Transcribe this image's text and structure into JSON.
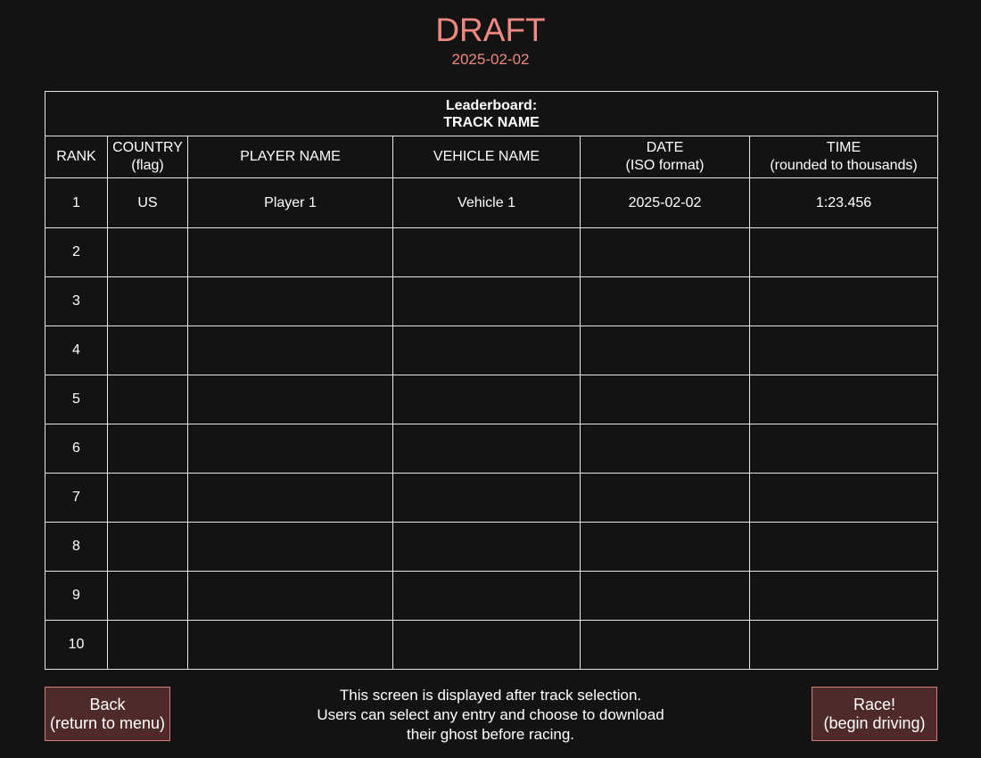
{
  "header": {
    "title": "DRAFT",
    "date": "2025-02-02"
  },
  "leaderboard": {
    "caption_line1": "Leaderboard:",
    "caption_line2": "TRACK NAME",
    "columns": [
      {
        "line1": "RANK",
        "line2": ""
      },
      {
        "line1": "COUNTRY",
        "line2": "(flag)"
      },
      {
        "line1": "PLAYER NAME",
        "line2": ""
      },
      {
        "line1": "VEHICLE NAME",
        "line2": ""
      },
      {
        "line1": "DATE",
        "line2": "(ISO format)"
      },
      {
        "line1": "TIME",
        "line2": "(rounded to thousands)"
      }
    ],
    "rows": [
      {
        "rank": "1",
        "country": "US",
        "player": "Player 1",
        "vehicle": "Vehicle 1",
        "date": "2025-02-02",
        "time": "1:23.456"
      },
      {
        "rank": "2",
        "country": "",
        "player": "",
        "vehicle": "",
        "date": "",
        "time": ""
      },
      {
        "rank": "3",
        "country": "",
        "player": "",
        "vehicle": "",
        "date": "",
        "time": ""
      },
      {
        "rank": "4",
        "country": "",
        "player": "",
        "vehicle": "",
        "date": "",
        "time": ""
      },
      {
        "rank": "5",
        "country": "",
        "player": "",
        "vehicle": "",
        "date": "",
        "time": ""
      },
      {
        "rank": "6",
        "country": "",
        "player": "",
        "vehicle": "",
        "date": "",
        "time": ""
      },
      {
        "rank": "7",
        "country": "",
        "player": "",
        "vehicle": "",
        "date": "",
        "time": ""
      },
      {
        "rank": "8",
        "country": "",
        "player": "",
        "vehicle": "",
        "date": "",
        "time": ""
      },
      {
        "rank": "9",
        "country": "",
        "player": "",
        "vehicle": "",
        "date": "",
        "time": ""
      },
      {
        "rank": "10",
        "country": "",
        "player": "",
        "vehicle": "",
        "date": "",
        "time": ""
      }
    ]
  },
  "buttons": {
    "back_line1": "Back",
    "back_line2": "(return to menu)",
    "race_line1": "Race!",
    "race_line2": "(begin driving)"
  },
  "note": {
    "line1": "This screen is displayed after track selection.",
    "line2": "Users can select any entry and choose to download",
    "line3": "their ghost before racing."
  },
  "colors": {
    "background": "#131313",
    "accent": "#f08a80",
    "button_fill": "#4e2a2a",
    "button_border": "#d77d77",
    "grid": "#e6e6e6"
  }
}
